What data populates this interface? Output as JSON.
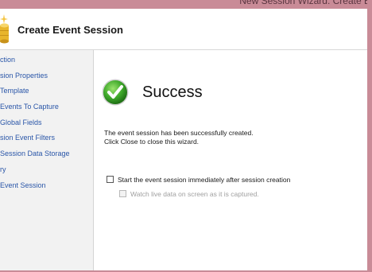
{
  "window": {
    "title": "New Session Wizard: Create E",
    "accent_color": "#c98b97"
  },
  "header": {
    "title": "Create Event Session",
    "icon": "database-wizard-icon"
  },
  "nav": {
    "items": [
      {
        "label": "ction"
      },
      {
        "label": "sion Properties"
      },
      {
        "label": "Template"
      },
      {
        "label": "Events To Capture"
      },
      {
        "label": "Global Fields"
      },
      {
        "label": "sion Event Filters"
      },
      {
        "label": "Session Data Storage"
      },
      {
        "label": "ry"
      },
      {
        "label": "Event Session"
      }
    ]
  },
  "main": {
    "status_title": "Success",
    "status_icon": "green-checkmark-icon",
    "message_line1": "The event session has been successfully created.",
    "message_line2": "Click Close to close this wizard.",
    "start_session_label": "Start the event session immediately after session creation",
    "start_session_checked": false,
    "watch_live_label": "Watch live data on screen as it is captured.",
    "watch_live_checked": false,
    "watch_live_enabled": false
  }
}
